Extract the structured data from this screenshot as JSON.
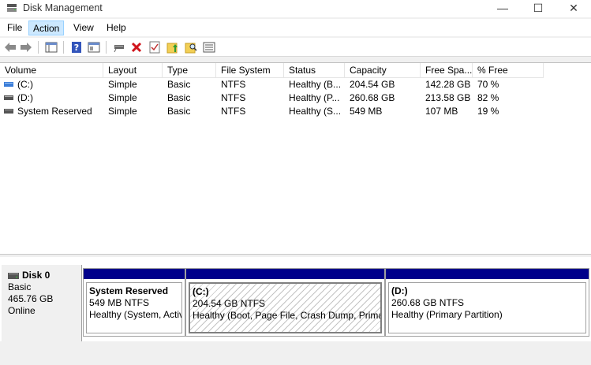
{
  "window": {
    "title": "Disk Management",
    "controls": {
      "minimize": "—",
      "maximize": "☐",
      "close": "✕"
    }
  },
  "menu": {
    "items": [
      {
        "label": "File"
      },
      {
        "label": "Action"
      },
      {
        "label": "View"
      },
      {
        "label": "Help"
      }
    ]
  },
  "toolbar": {
    "icons": [
      "back-icon",
      "forward-icon",
      "console-tree-icon",
      "help-icon",
      "properties-icon",
      "connect-disk-icon",
      "delete-icon",
      "check-icon",
      "folder-up-icon",
      "search-folder-icon",
      "list-icon"
    ]
  },
  "volumes": {
    "columns": [
      "Volume",
      "Layout",
      "Type",
      "File System",
      "Status",
      "Capacity",
      "Free Spa...",
      "% Free"
    ],
    "rows": [
      {
        "volume": "(C:)",
        "layout": "Simple",
        "type": "Basic",
        "fs": "NTFS",
        "status": "Healthy (B...",
        "capacity": "204.54 GB",
        "free": "142.28 GB",
        "pct": "70 %"
      },
      {
        "volume": "(D:)",
        "layout": "Simple",
        "type": "Basic",
        "fs": "NTFS",
        "status": "Healthy (P...",
        "capacity": "260.68 GB",
        "free": "213.58 GB",
        "pct": "82 %"
      },
      {
        "volume": "System Reserved",
        "layout": "Simple",
        "type": "Basic",
        "fs": "NTFS",
        "status": "Healthy (S...",
        "capacity": "549 MB",
        "free": "107 MB",
        "pct": "19 %"
      }
    ]
  },
  "disk": {
    "name": "Disk 0",
    "type": "Basic",
    "size": "465.76 GB",
    "state": "Online",
    "partitions": [
      {
        "name": "System Reserved",
        "size": "549 MB NTFS",
        "status": "Healthy (System, Active, Primary Partition)"
      },
      {
        "name": "(C:)",
        "size": "204.54 GB NTFS",
        "status": "Healthy (Boot, Page File, Crash Dump, Primary Partition)"
      },
      {
        "name": "(D:)",
        "size": "260.68 GB NTFS",
        "status": "Healthy (Primary Partition)"
      }
    ]
  },
  "colors": {
    "partition_bar": "#00008b",
    "selection": "#cce8ff"
  }
}
